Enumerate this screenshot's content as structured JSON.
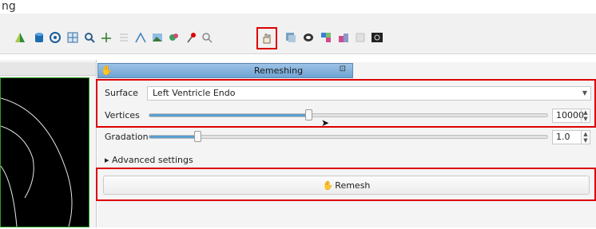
{
  "window": {
    "title_fragment": "ng"
  },
  "toolbar": {
    "icons": [
      "green-yellow-shape-icon",
      "blue-cylinder-icon",
      "target-circle-icon",
      "grid-measure-icon",
      "magnifier-icon",
      "axis-cross-icon",
      "lines-icon",
      "angle-measure-icon",
      "landscape-image-icon",
      "paint-splash-icon",
      "red-pin-icon",
      "zoom-search-icon",
      "remesh-hand-icon",
      "mesh-stack-icon",
      "brain-icon",
      "colored-mesh-icon",
      "mesh-pair-icon",
      "faded-box-icon",
      "dark-display-icon"
    ],
    "highlighted_icon": "remesh-hand-icon"
  },
  "dock": {
    "title": "Remeshing",
    "float_symbol": "⊡",
    "surface_label": "Surface",
    "surface_value": "Left Ventricle Endo",
    "vertices_label": "Vertices",
    "vertices_value": "10000",
    "vertices_fraction": 0.4,
    "gradation_label": "Gradation",
    "gradation_value": "1.0",
    "gradation_fraction": 0.12,
    "advanced_label": "▸ Advanced settings",
    "remesh_button": "Remesh"
  },
  "colors": {
    "highlight": "#dd0000",
    "title_bar": "#8db8e0",
    "slider_fill": "#5a9ed0",
    "viewport_border": "#2ca02c"
  }
}
